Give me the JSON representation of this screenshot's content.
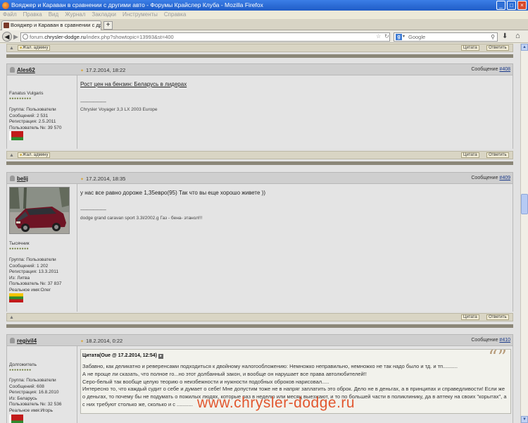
{
  "window": {
    "title": "Вояджер и Караван в сравнении с другими авто - Форумы Крайслер Клуба - Mozilla Firefox"
  },
  "menu": [
    "Файл",
    "Правка",
    "Вид",
    "Журнал",
    "Закладки",
    "Инструменты",
    "Справка"
  ],
  "tab": {
    "label": "Вояджер и Караван в сравнении с другим...",
    "new_tab": "+"
  },
  "nav": {
    "url_prefix": "forum.",
    "url_host": "chrysler-dodge.ru",
    "url_path": "/index.php?showtopic=13993&st=400",
    "search_placeholder": "Google",
    "search_engine": "g"
  },
  "buttons": {
    "report": "Жал. админу",
    "quote": "Цитата",
    "reply": "Ответить"
  },
  "message_label": "Сообщение",
  "posts": [
    {
      "username": "Ales62",
      "date": "17.2.2014, 18:22",
      "msg_num": "#408",
      "user_title": "Fanatus Vulgaris",
      "stars": "●●●●●●●●●",
      "info": [
        "Группа: Пользователи",
        "Сообщений: 2 531",
        "Регистрация: 2.5.2011",
        "Пользователь №: 39 570"
      ],
      "text": "Рост цен на бензин: Беларусь в лидерах",
      "sig_sep": "--------------------",
      "signature": "Chrysler Voyager 3,3 LX 2003 Europe",
      "flag": "Belarus"
    },
    {
      "username": "belij",
      "date": "17.2.2014, 18:35",
      "msg_num": "#409",
      "user_title": "Тысячник",
      "stars": "●●●●●●●●",
      "info": [
        "Группа: Пользователи",
        "Сообщений: 1 202",
        "Регистрация: 13.3.2011",
        "Из: Литва",
        "Пользователь №: 37 837",
        "Реальное имя:Олег"
      ],
      "text": "у нас все равно дороже 1,35евро(95) Так что вы еще хорошо живете ))",
      "sig_sep": "--------------------",
      "signature": "dodge grand caravan sport 3.3l/2002.g Газ - бена- этанол!!!",
      "flag": "Lithuania"
    },
    {
      "username": "regivil4",
      "date": "18.2.2014, 0:22",
      "msg_num": "#410",
      "user_title": "Долгожитель",
      "stars": "●●●●●●●●●",
      "info": [
        "Группа: Пользователи",
        "Сообщений: 608",
        "Регистрация: 16.8.2010",
        "Из: Беларусь",
        "Пользователь №: 32 536",
        "Реальное имя:Игорь"
      ],
      "quote_head": "Цитата(Oue @ 17.2.2014, 12:54)",
      "quote_lines": [
        "Забавно, как деликатно и реверенсами подходиться к двойному налогообложению: Немножко неправильно, немножко не так надо было и тд. и тп..........",
        "А не проще ли сказать, что полное го...но этот долбанный закон, и вообще он нарушает все права автолюбителей!!",
        "Серо-белый так вообще целую теорию о неизбежности и нужности подобных оброков нарисовал.....",
        "Интересно то, что каждый судит о себе и думает о себе! Мне допустим тоже не в напряг заплатить это оброк. Дело не в деньгах, а в принципах и справедливости! Если же о деньгах, то почему бы не подумать о пожилых людях, которые раз в неделю или месяц выезжают, и то по большей части в поликлинику, да в аптеку на своих \"корытах\", а с них требуют столько же, сколько и с ..........."
      ]
    }
  ],
  "watermark": "www.chrysler-dodge.ru"
}
